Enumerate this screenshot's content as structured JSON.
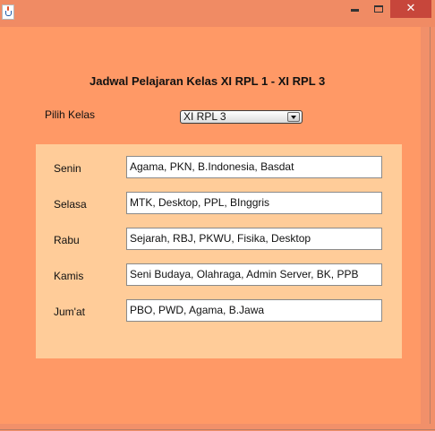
{
  "window": {
    "title": "",
    "close_glyph": "✕"
  },
  "main": {
    "title": "Jadwal Pelajaran Kelas XI RPL 1 - XI RPL 3",
    "class_label": "Pilih Kelas",
    "class_select": {
      "selected": "XI RPL 3"
    }
  },
  "schedule": {
    "rows": [
      {
        "day": "Senin",
        "subjects": "Agama, PKN, B.Indonesia, Basdat"
      },
      {
        "day": "Selasa",
        "subjects": "MTK, Desktop, PPL, BInggris"
      },
      {
        "day": "Rabu",
        "subjects": "Sejarah, RBJ, PKWU, Fisika, Desktop"
      },
      {
        "day": "Kamis",
        "subjects": "Seni Budaya, Olahraga, Admin Server, BK, PPB"
      },
      {
        "day": "Jum'at",
        "subjects": "PBO, PWD, Agama, B.Jawa"
      }
    ]
  },
  "icons": {
    "app": "java-cup-icon",
    "minimize": "minimize-icon",
    "maximize": "maximize-icon",
    "close": "close-icon",
    "dropdown": "chevron-down-icon"
  },
  "colors": {
    "background": "#ff9966",
    "panel": "#ffcc99",
    "close_button": "#c7463b"
  }
}
